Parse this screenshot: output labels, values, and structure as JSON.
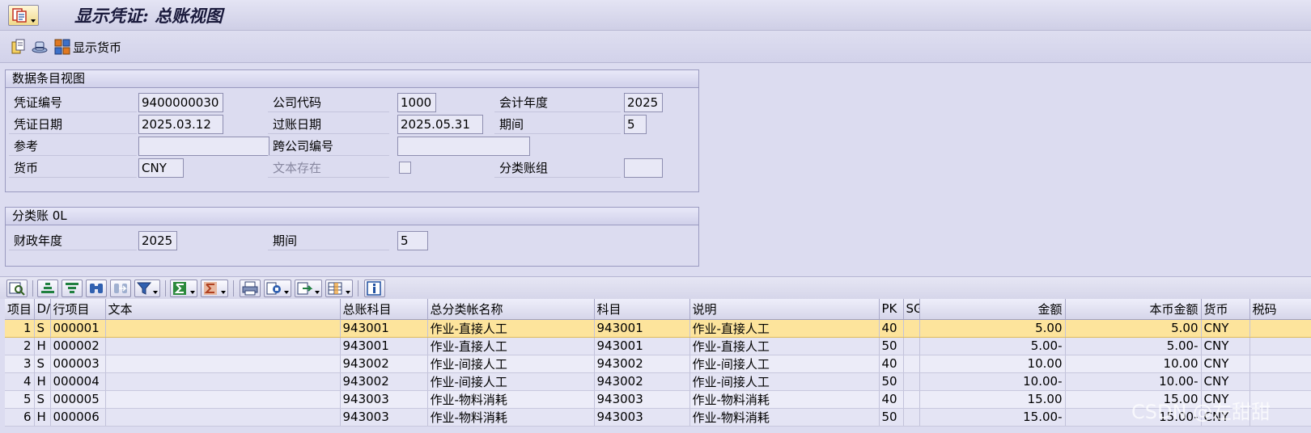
{
  "window": {
    "title": "显示凭证: 总账视图"
  },
  "toolbar": {
    "display_currency_label": "显示货币"
  },
  "header_group": {
    "title": "数据条目视图",
    "doc_number_label": "凭证编号",
    "doc_number": "9400000030",
    "company_code_label": "公司代码",
    "company_code": "1000",
    "fiscal_year_label": "会计年度",
    "fiscal_year": "2025",
    "doc_date_label": "凭证日期",
    "doc_date": "2025.03.12",
    "posting_date_label": "过账日期",
    "posting_date": "2025.05.31",
    "period_label": "期间",
    "period": "5",
    "reference_label": "参考",
    "reference": "",
    "cross_company_label": "跨公司编号",
    "cross_company": "",
    "currency_label": "货币",
    "currency": "CNY",
    "text_exists_label": "文本存在",
    "ledger_group_label": "分类账组",
    "ledger_group": ""
  },
  "ledger_group": {
    "title": "分类账 0L",
    "fiscal_year_label": "财政年度",
    "fiscal_year": "2025",
    "period_label": "期间",
    "period": "5"
  },
  "grid": {
    "headers": {
      "item": "项目",
      "dc": "D/",
      "line_item": "行项目",
      "text": "文本",
      "gl_account": "总账科目",
      "gl_name": "总分类帐名称",
      "account": "科目",
      "description": "说明",
      "pk": "PK",
      "sg": "SG",
      "amount": "金额",
      "local_amount": "本币金额",
      "currency": "货币",
      "tax": "税码"
    },
    "rows": [
      {
        "item": "1",
        "dc": "S",
        "line_item": "000001",
        "text": "",
        "gl_account": "943001",
        "gl_name": "作业-直接人工",
        "account": "943001",
        "description": "作业-直接人工",
        "pk": "40",
        "sg": "",
        "amount": "5.00",
        "local_amount": "5.00",
        "currency": "CNY",
        "tax": ""
      },
      {
        "item": "2",
        "dc": "H",
        "line_item": "000002",
        "text": "",
        "gl_account": "943001",
        "gl_name": "作业-直接人工",
        "account": "943001",
        "description": "作业-直接人工",
        "pk": "50",
        "sg": "",
        "amount": "5.00-",
        "local_amount": "5.00-",
        "currency": "CNY",
        "tax": ""
      },
      {
        "item": "3",
        "dc": "S",
        "line_item": "000003",
        "text": "",
        "gl_account": "943002",
        "gl_name": "作业-间接人工",
        "account": "943002",
        "description": "作业-间接人工",
        "pk": "40",
        "sg": "",
        "amount": "10.00",
        "local_amount": "10.00",
        "currency": "CNY",
        "tax": ""
      },
      {
        "item": "4",
        "dc": "H",
        "line_item": "000004",
        "text": "",
        "gl_account": "943002",
        "gl_name": "作业-间接人工",
        "account": "943002",
        "description": "作业-间接人工",
        "pk": "50",
        "sg": "",
        "amount": "10.00-",
        "local_amount": "10.00-",
        "currency": "CNY",
        "tax": ""
      },
      {
        "item": "5",
        "dc": "S",
        "line_item": "000005",
        "text": "",
        "gl_account": "943003",
        "gl_name": "作业-物料消耗",
        "account": "943003",
        "description": "作业-物料消耗",
        "pk": "40",
        "sg": "",
        "amount": "15.00",
        "local_amount": "15.00",
        "currency": "CNY",
        "tax": ""
      },
      {
        "item": "6",
        "dc": "H",
        "line_item": "000006",
        "text": "",
        "gl_account": "943003",
        "gl_name": "作业-物料消耗",
        "account": "943003",
        "description": "作业-物料消耗",
        "pk": "50",
        "sg": "",
        "amount": "15.00-",
        "local_amount": "15.00-",
        "currency": "CNY",
        "tax": ""
      }
    ]
  },
  "watermark": "CSDN @左甜甜"
}
